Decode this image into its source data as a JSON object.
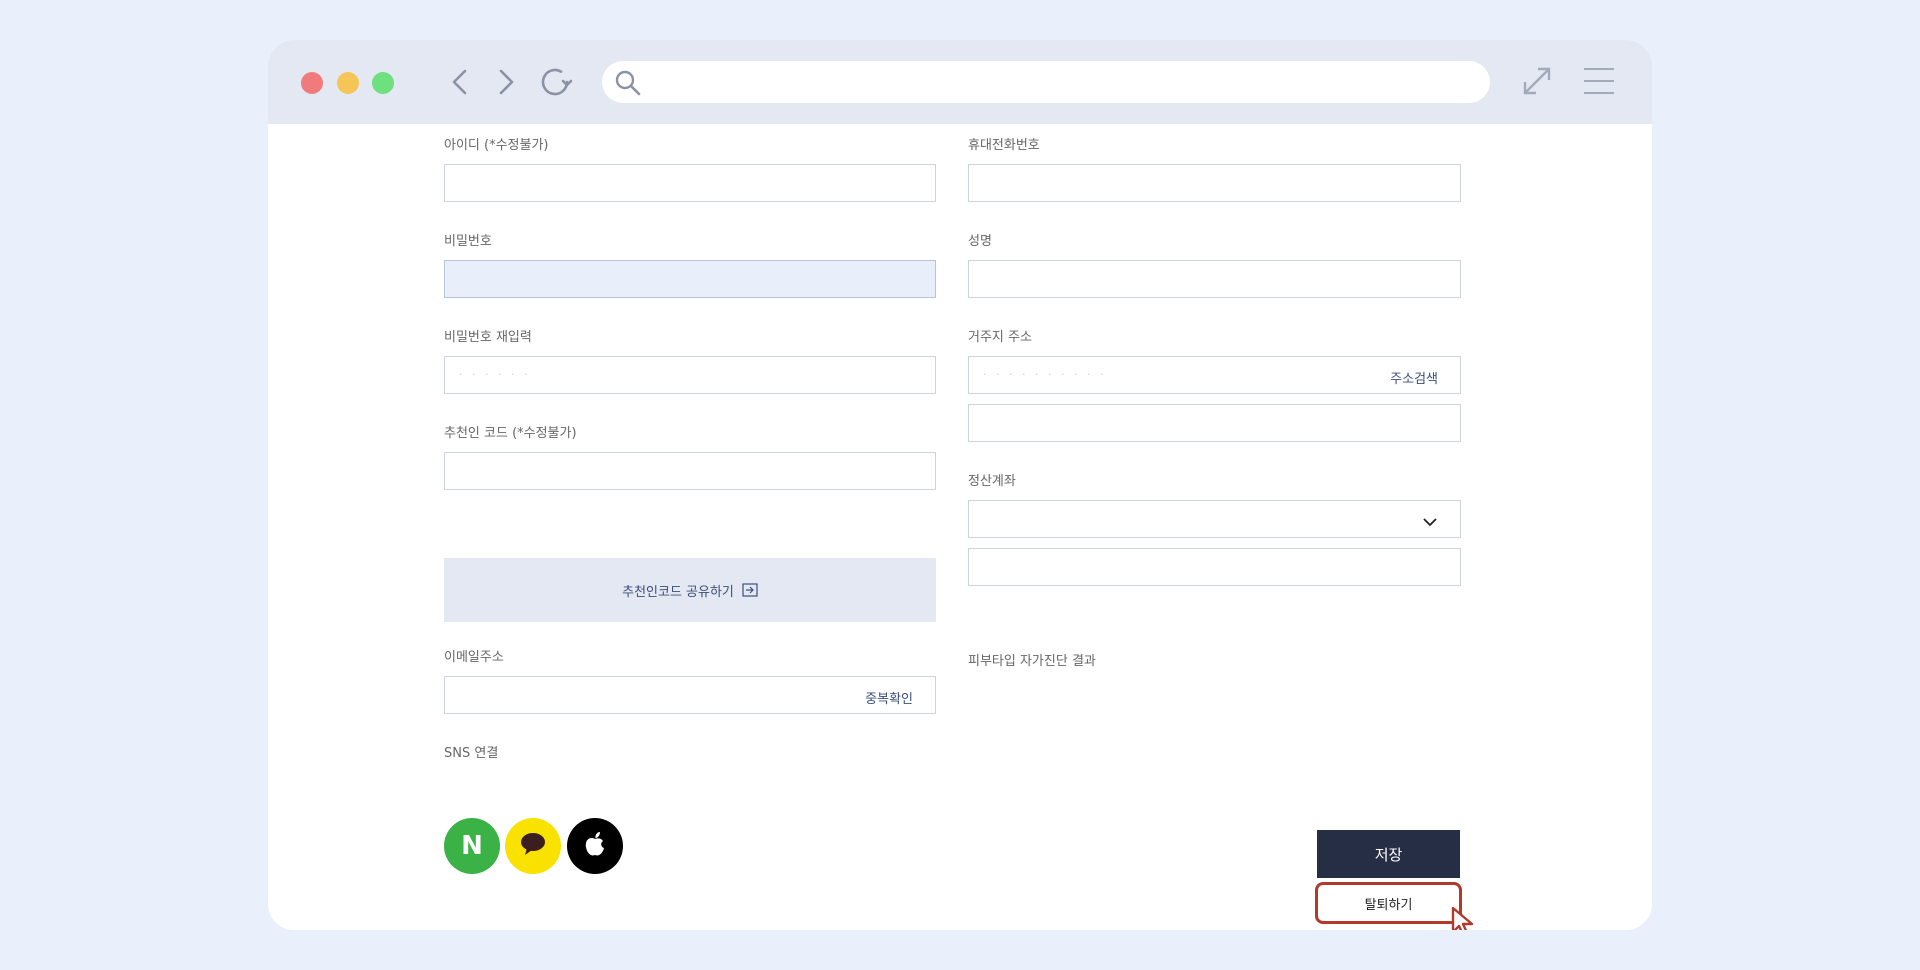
{
  "browser": {
    "address_value": "",
    "icons": [
      "back-arrow-icon",
      "forward-arrow-icon",
      "reload-icon",
      "search-icon",
      "expand-icon",
      "hamburger-menu-icon"
    ]
  },
  "form": {
    "id_label": "아이디 (*수정불가)",
    "id_value": "",
    "phone_label": "휴대전화번호",
    "phone_value": "",
    "password_label": "비밀번호",
    "password_value": "",
    "name_label": "성명",
    "name_value": "",
    "password_confirm_label": "비밀번호 재입력",
    "password_confirm_value": "",
    "address_label": "거주지 주소",
    "address_search": "주소검색",
    "address_value": "",
    "address_detail_value": "",
    "referral_label": "추천인 코드 (*수정불가)",
    "referral_value": "",
    "share_referral": "추천인코드 공유하기",
    "account_label": "정산계좌",
    "account_select_value": "",
    "account_number_value": "",
    "email_label": "이메일주소",
    "email_value": "",
    "email_check": "중복확인",
    "skin_label": "피부타입 자가진단 결과",
    "sns_label": "SNS 연결",
    "naver_letter": "N",
    "save": "저장",
    "withdraw": "탈퇴하기"
  },
  "colors": {
    "page_background": "#e9f0fc",
    "naver": "#3bb246",
    "kakao": "#fae200",
    "apple": "#000000",
    "save_button": "#262e45",
    "highlight": "#b23a2a",
    "focused_field": "#e9eefb"
  }
}
